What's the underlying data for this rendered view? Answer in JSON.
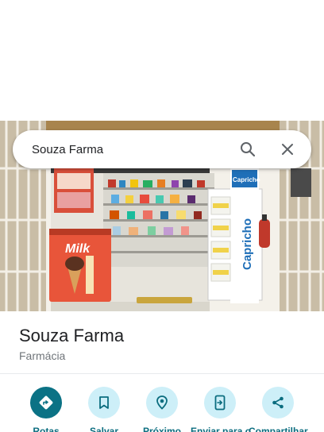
{
  "search": {
    "query": "Souza Farma"
  },
  "photo": {
    "sign_milk": "Milk",
    "sign_capricho_top": "Capricho",
    "sign_capricho_side": "Capricho"
  },
  "place": {
    "name": "Souza Farma",
    "category": "Farmácia"
  },
  "actions": [
    {
      "label": "Rotas",
      "icon": "directions-icon"
    },
    {
      "label": "Salvar",
      "icon": "bookmark-icon"
    },
    {
      "label": "Próximo",
      "icon": "nearby-icon"
    },
    {
      "label": "Enviar para o",
      "icon": "send-to-phone-icon"
    },
    {
      "label": "Compartilhar",
      "icon": "share-icon"
    }
  ],
  "colors": {
    "primary": "#0b7285",
    "action_bg": "#cdeff8",
    "label": "#0b6d7f"
  }
}
